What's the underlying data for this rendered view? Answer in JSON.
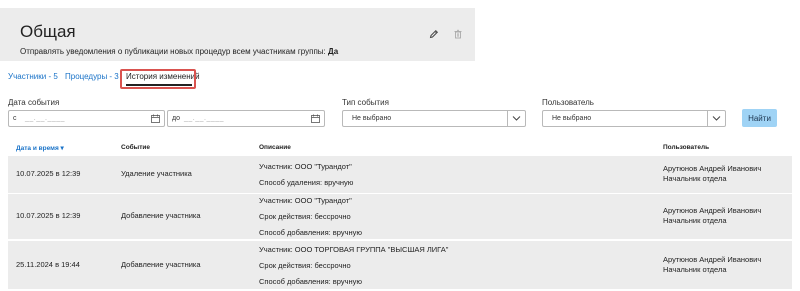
{
  "group": {
    "title": "Общая",
    "notice_text": "Отправлять уведомления о публикации новых процедур всем участникам группы:",
    "notice_value": "Да"
  },
  "tabs": [
    {
      "label": "Участники - 5",
      "active": false
    },
    {
      "label": "Процедуры - 3",
      "active": false
    },
    {
      "label": "История изменений",
      "active": true
    }
  ],
  "filters": {
    "date_label": "Дата события",
    "from_prefix": "с",
    "to_prefix": "до",
    "date_placeholder": "__.__.____",
    "event_type_label": "Тип события",
    "event_type_value": "Не выбрано",
    "user_label": "Пользователь",
    "user_value": "Не выбрано",
    "find_button": "Найти"
  },
  "table": {
    "columns": [
      "Дата и время ▾",
      "Событие",
      "Описание",
      "Пользователь"
    ],
    "rows": [
      {
        "datetime": "10.07.2025 в 12:39",
        "event": "Удаление участника",
        "description": [
          "Участник: ООО \"Турандот\"",
          "Способ удаления: вручную"
        ],
        "user_name": "Арутюнов Андрей Иванович",
        "user_role": "Начальник отдела"
      },
      {
        "datetime": "10.07.2025 в 12:39",
        "event": "Добавление участника",
        "description": [
          "Участник: ООО \"Турандот\"",
          "Срок действия: бессрочно",
          "Способ добавления: вручную"
        ],
        "user_name": "Арутюнов Андрей Иванович",
        "user_role": "Начальник отдела"
      },
      {
        "datetime": "25.11.2024 в 19:44",
        "event": "Добавление участника",
        "description": [
          "Участник: ООО ТОРГОВАЯ ГРУППА \"ВЫСШАЯ ЛИГА\"",
          "Срок действия: бессрочно",
          "Способ добавления: вручную"
        ],
        "user_name": "Арутюнов Андрей Иванович",
        "user_role": "Начальник отдела"
      }
    ]
  },
  "colors": {
    "link": "#1a73c8",
    "highlight": "#d9534f",
    "button_bg": "#9fd3f5",
    "row_bg": "#ececec"
  }
}
